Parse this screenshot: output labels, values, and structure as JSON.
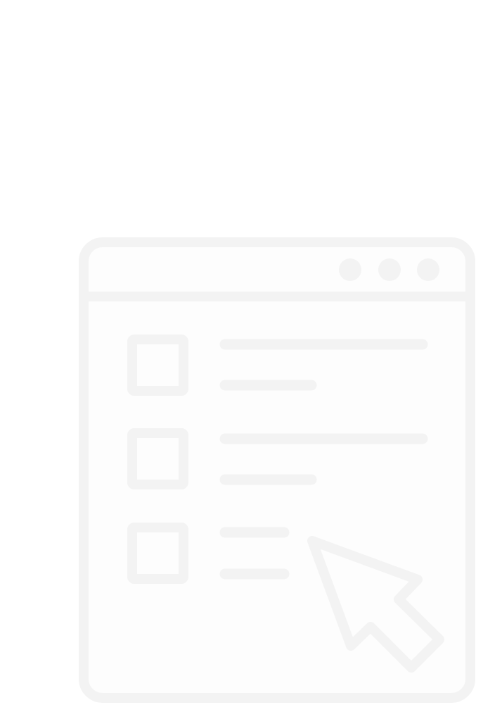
{
  "illustration": {
    "icon": "browser-window-checklist-cursor-icon",
    "stroke_color": "#f3f3f3",
    "fill_color": "#fdfdfd",
    "window_dots": 3,
    "checklist_items": 3
  }
}
